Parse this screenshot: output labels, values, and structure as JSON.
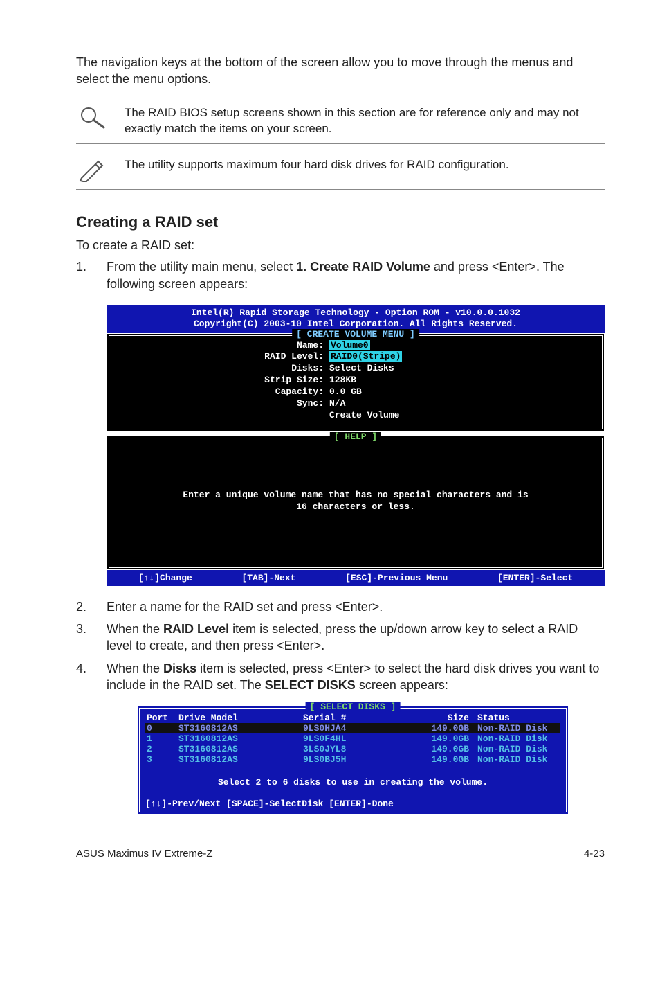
{
  "intro_text": "The navigation keys at the bottom of the screen allow you to move through the menus and select the menu options.",
  "note1": "The RAID BIOS setup screens shown in this section are for reference only and may not exactly match the items on your screen.",
  "note2": "The utility supports maximum four hard disk drives for RAID configuration.",
  "heading": "Creating a RAID set",
  "sub_intro": "To create a RAID set:",
  "steps": {
    "s1_num": "1.",
    "s1_a": "From the utility main menu, select ",
    "s1_b": "1. Create RAID Volume",
    "s1_c": " and press <Enter>. The following screen appears:",
    "s2_num": "2.",
    "s2": "Enter a name for the RAID set and press <Enter>.",
    "s3_num": "3.",
    "s3_a": "When the ",
    "s3_b": "RAID Level",
    "s3_c": " item is selected, press the up/down arrow key to select a RAID level to create, and then press <Enter>.",
    "s4_num": "4.",
    "s4_a": "When the ",
    "s4_b": "Disks",
    "s4_c": " item is selected, press <Enter> to select the hard disk drives you want to include in the RAID set. The ",
    "s4_d": "SELECT DISKS",
    "s4_e": " screen appears:"
  },
  "bios1": {
    "top1": "Intel(R) Rapid Storage Technology - Option ROM - v10.0.0.1032",
    "top2": "Copyright(C) 2003-10 Intel Corporation.  All Rights Reserved.",
    "legend_create": "[ CREATE VOLUME MENU ]",
    "kv": {
      "name_k": "Name:",
      "name_v": "Volume0",
      "raid_k": "RAID Level:",
      "raid_v": "RAID0(Stripe)",
      "disks_k": "Disks:",
      "disks_v": "Select Disks",
      "strip_k": "Strip Size:",
      "strip_v": "128KB",
      "cap_k": "Capacity:",
      "cap_v": "0.0   GB",
      "sync_k": "Sync:",
      "sync_v": "N/A",
      "create": "Create Volume"
    },
    "legend_help": "[ HELP ]",
    "help1": "Enter a unique volume name that has no special characters and is",
    "help2": "16 characters or less.",
    "bottom": {
      "b1": "[↑↓]Change",
      "b2": "[TAB]-Next",
      "b3": "[ESC]-Previous Menu",
      "b4": "[ENTER]-Select"
    }
  },
  "disks": {
    "legend": "[ SELECT DISKS ]",
    "header": {
      "port": "Port",
      "model": "Drive Model",
      "serial": "Serial #",
      "size": "Size",
      "status": "Status"
    },
    "rows": [
      {
        "port": "0",
        "model": "ST3160812AS",
        "serial": "9LS0HJA4",
        "size": "149.0GB",
        "status": "Non-RAID Disk"
      },
      {
        "port": "1",
        "model": "ST3160812AS",
        "serial": "9LS0F4HL",
        "size": "149.0GB",
        "status": "Non-RAID Disk"
      },
      {
        "port": "2",
        "model": "ST3160812AS",
        "serial": "3LS0JYL8",
        "size": "149.0GB",
        "status": "Non-RAID Disk"
      },
      {
        "port": "3",
        "model": "ST3160812AS",
        "serial": "9LS0BJ5H",
        "size": "149.0GB",
        "status": "Non-RAID Disk"
      }
    ],
    "note": "Select 2 to 6 disks to use in creating the volume.",
    "foot": "[↑↓]-Prev/Next [SPACE]-SelectDisk [ENTER]-Done"
  },
  "footer": {
    "left": "ASUS Maximus IV Extreme-Z",
    "right": "4-23"
  }
}
